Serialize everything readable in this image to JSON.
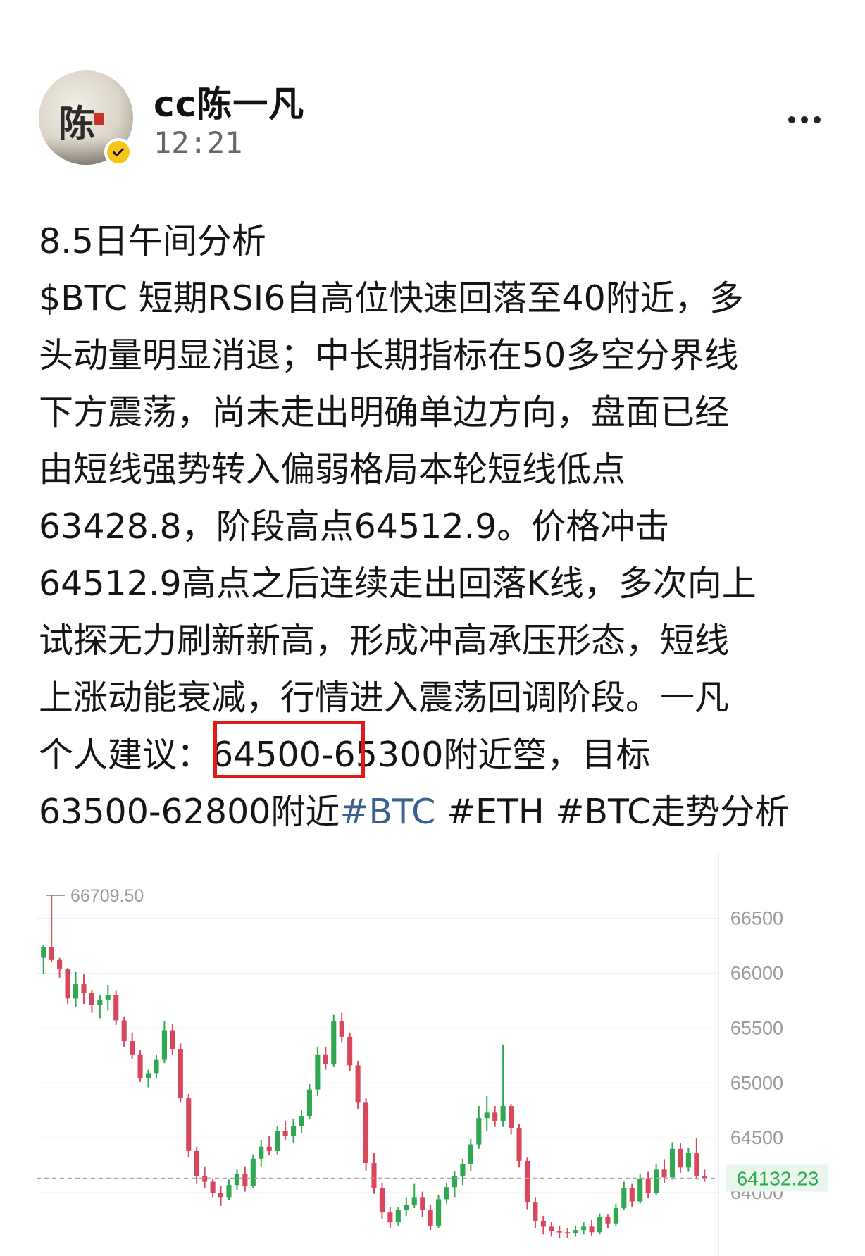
{
  "user": {
    "name": "cc陈一凡",
    "time": "12:21",
    "avatar_glyph": "陈",
    "badge": "verified-check-icon"
  },
  "post": {
    "title": "8.5日午间分析",
    "lines": [
      "$BTC 短期RSI6自高位快速回落至40附近，多",
      "头动量明显消退；中长期指标在50多空分界线",
      "下方震荡，尚未走出明确单边方向，盘面已经",
      "由短线强势转入偏弱格局本轮短线低点",
      "63428.8，阶段高点64512.9。价格冲击",
      "64512.9高点之后连续走出回落K线，多次向上",
      "试探无力刷新新高，形成冲高承压形态，短线",
      "上涨动能衰减，行情进入震荡回调阶段。一凡"
    ],
    "line9": "个人建议：64500-65300附近箜，目标",
    "line10_text": "63500-62800附近",
    "tags": [
      "#BTC",
      "#ETH",
      "#BTC走势分析"
    ]
  },
  "chart_data": {
    "type": "candlestick",
    "high_label": "66709.50",
    "last_price": "64132.23",
    "y_tick_labels": [
      "66500",
      "66000",
      "65500",
      "65000",
      "64500",
      "64000"
    ],
    "y_ticks": [
      66500,
      66000,
      65500,
      65000,
      64500,
      64000
    ],
    "ylim": [
      63590,
      66780
    ],
    "last_value": 64132.23,
    "up_color": "#2fa84f",
    "down_color": "#d9475a",
    "candles": [
      [
        66140,
        66260,
        65990,
        66240
      ],
      [
        66240,
        66710,
        66100,
        66120
      ],
      [
        66120,
        66140,
        65960,
        66040
      ],
      [
        66040,
        66050,
        65720,
        65770
      ],
      [
        65770,
        66010,
        65690,
        65900
      ],
      [
        65900,
        65990,
        65720,
        65820
      ],
      [
        65820,
        65850,
        65640,
        65710
      ],
      [
        65710,
        65800,
        65590,
        65760
      ],
      [
        65760,
        65890,
        65660,
        65800
      ],
      [
        65800,
        65840,
        65530,
        65570
      ],
      [
        65570,
        65600,
        65330,
        65380
      ],
      [
        65380,
        65460,
        65220,
        65260
      ],
      [
        65260,
        65300,
        65010,
        65040
      ],
      [
        65040,
        65120,
        64960,
        65090
      ],
      [
        65090,
        65260,
        65040,
        65210
      ],
      [
        65210,
        65560,
        65180,
        65480
      ],
      [
        65480,
        65540,
        65260,
        65310
      ],
      [
        65310,
        65360,
        64820,
        64860
      ],
      [
        64860,
        64900,
        64320,
        64380
      ],
      [
        64380,
        64420,
        64080,
        64150
      ],
      [
        64150,
        64240,
        64040,
        64100
      ],
      [
        64100,
        64130,
        63960,
        64000
      ],
      [
        64000,
        64060,
        63880,
        63960
      ],
      [
        63960,
        64120,
        63930,
        64070
      ],
      [
        64070,
        64210,
        64020,
        64170
      ],
      [
        64170,
        64240,
        64010,
        64060
      ],
      [
        64060,
        64350,
        64040,
        64310
      ],
      [
        64310,
        64480,
        64240,
        64420
      ],
      [
        64420,
        64520,
        64340,
        64380
      ],
      [
        64380,
        64610,
        64350,
        64560
      ],
      [
        64560,
        64650,
        64480,
        64520
      ],
      [
        64520,
        64670,
        64450,
        64610
      ],
      [
        64610,
        64750,
        64540,
        64700
      ],
      [
        64700,
        64990,
        64670,
        64940
      ],
      [
        64940,
        65330,
        64880,
        65260
      ],
      [
        65260,
        65330,
        65120,
        65170
      ],
      [
        65170,
        65620,
        65150,
        65560
      ],
      [
        65560,
        65640,
        65370,
        65420
      ],
      [
        65420,
        65460,
        65110,
        65160
      ],
      [
        65160,
        65200,
        64760,
        64820
      ],
      [
        64820,
        64860,
        64200,
        64270
      ],
      [
        64270,
        64360,
        63990,
        64040
      ],
      [
        64040,
        64090,
        63760,
        63820
      ],
      [
        63820,
        63870,
        63680,
        63730
      ],
      [
        63730,
        63870,
        63700,
        63840
      ],
      [
        63840,
        63960,
        63790,
        63890
      ],
      [
        63890,
        64080,
        63860,
        63960
      ],
      [
        63960,
        64010,
        63780,
        63840
      ],
      [
        63840,
        63890,
        63660,
        63700
      ],
      [
        63700,
        63980,
        63680,
        63940
      ],
      [
        63940,
        64090,
        63900,
        64050
      ],
      [
        64050,
        64200,
        63960,
        64150
      ],
      [
        64150,
        64310,
        64070,
        64260
      ],
      [
        64260,
        64490,
        64200,
        64440
      ],
      [
        64440,
        64790,
        64400,
        64680
      ],
      [
        64680,
        64880,
        64560,
        64730
      ],
      [
        64730,
        64790,
        64600,
        64650
      ],
      [
        64650,
        65350,
        64600,
        64790
      ],
      [
        64790,
        64810,
        64530,
        64590
      ],
      [
        64590,
        64630,
        64230,
        64290
      ],
      [
        64290,
        64320,
        63850,
        63910
      ],
      [
        63910,
        63960,
        63680,
        63740
      ],
      [
        63740,
        63790,
        63620,
        63690
      ],
      [
        63690,
        63730,
        63600,
        63650
      ],
      [
        63650,
        63700,
        63590,
        63640
      ],
      [
        63640,
        63680,
        63590,
        63630
      ],
      [
        63630,
        63700,
        63600,
        63660
      ],
      [
        63660,
        63730,
        63620,
        63690
      ],
      [
        63690,
        63750,
        63610,
        63640
      ],
      [
        63640,
        63810,
        63620,
        63780
      ],
      [
        63780,
        63800,
        63680,
        63720
      ],
      [
        63720,
        63900,
        63700,
        63860
      ],
      [
        63860,
        64100,
        63840,
        64040
      ],
      [
        64040,
        64080,
        63870,
        63920
      ],
      [
        63920,
        64170,
        63900,
        64130
      ],
      [
        64130,
        64190,
        63950,
        64000
      ],
      [
        64000,
        64260,
        63980,
        64210
      ],
      [
        64210,
        64300,
        64090,
        64140
      ],
      [
        64140,
        64460,
        64120,
        64400
      ],
      [
        64400,
        64450,
        64180,
        64230
      ],
      [
        64230,
        64410,
        64190,
        64360
      ],
      [
        64360,
        64500,
        64120,
        64150
      ],
      [
        64150,
        64210,
        64100,
        64132
      ]
    ]
  }
}
